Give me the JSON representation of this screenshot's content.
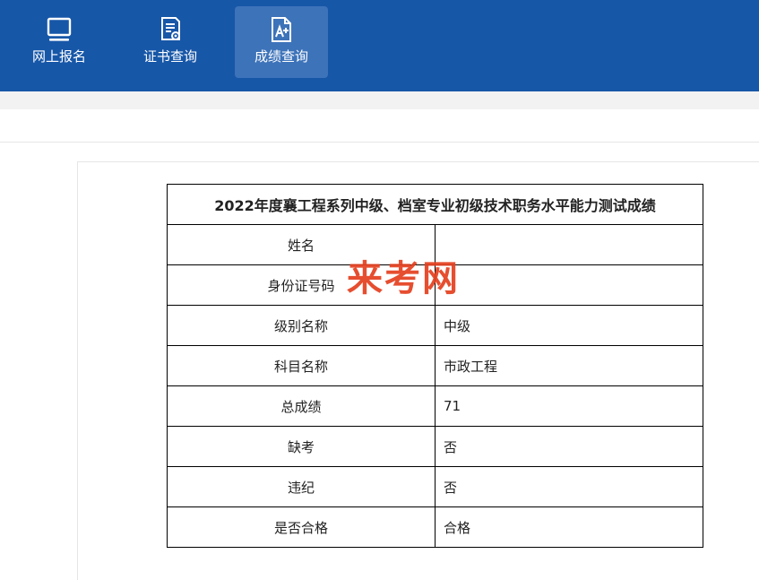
{
  "nav": {
    "items": [
      {
        "label": "网上报名",
        "icon": "monitor-icon"
      },
      {
        "label": "证书查询",
        "icon": "certificate-icon"
      },
      {
        "label": "成绩查询",
        "icon": "score-document-icon",
        "active": true
      }
    ]
  },
  "score_table": {
    "title": "2022年度襄工程系列中级、档室专业初级技术职务水平能力测试成绩",
    "rows": [
      {
        "label": "姓名",
        "value": ""
      },
      {
        "label": "身份证号码",
        "value": ""
      },
      {
        "label": "级别名称",
        "value": "中级"
      },
      {
        "label": "科目名称",
        "value": "市政工程"
      },
      {
        "label": "总成绩",
        "value": "71"
      },
      {
        "label": "缺考",
        "value": "否"
      },
      {
        "label": "违纪",
        "value": "否"
      },
      {
        "label": "是否合格",
        "value": "合格"
      }
    ]
  },
  "watermark": {
    "text": "来考网",
    "color": "#e4401f"
  },
  "colors": {
    "header_bg": "#1757a8",
    "active_nav_bg": "#3d73b9"
  }
}
